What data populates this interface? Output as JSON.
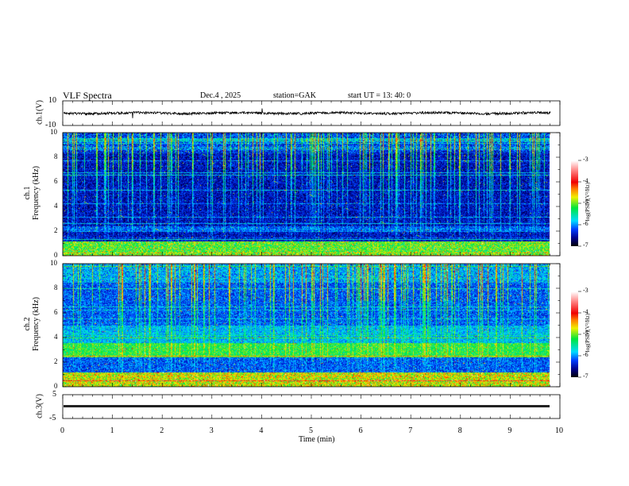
{
  "header": {
    "title": "VLF Spectra",
    "date": "Dec.4 , 2025",
    "station": "station=GAK",
    "start": "start UT = 13: 40: 0"
  },
  "chart_data": [
    {
      "type": "line",
      "ylabel": "ch.1(V)",
      "ylim": [
        -10,
        10
      ],
      "yticks": [
        "10",
        "-10"
      ],
      "xlim": [
        0,
        10
      ],
      "description_level": "noisy waveform near 0 V with spikes"
    },
    {
      "type": "heatmap",
      "ylabel_top": "ch.1",
      "ylabel": "Frequency (kHz)",
      "ylim": [
        0,
        10
      ],
      "yticks": [
        "0",
        "2",
        "4",
        "6",
        "8",
        "10"
      ],
      "xlim": [
        0,
        10
      ],
      "colorbar": {
        "label": "log(PSD)(V²/Hz)",
        "range": [
          -7,
          -3
        ],
        "ticks": [
          "-3",
          "-4",
          "-5",
          "-6",
          "-7"
        ]
      }
    },
    {
      "type": "heatmap",
      "ylabel_top": "ch.2",
      "ylabel": "Frequency (kHz)",
      "ylim": [
        0,
        10
      ],
      "yticks": [
        "0",
        "2",
        "4",
        "6",
        "8",
        "10"
      ],
      "xlim": [
        0,
        10
      ],
      "colorbar": {
        "label": "log(PSD)(V²/Hz)",
        "range": [
          -7,
          -3
        ],
        "ticks": [
          "-3",
          "-4",
          "-5",
          "-6",
          "-7"
        ]
      }
    },
    {
      "type": "line",
      "ylabel": "ch.3(V)",
      "ylim": [
        -5,
        5
      ],
      "yticks": [
        "5",
        "-5"
      ],
      "xlim": [
        0,
        10
      ],
      "xlabel": "Time (min)",
      "xticks": [
        "0",
        "1",
        "2",
        "3",
        "4",
        "5",
        "6",
        "7",
        "8",
        "9",
        "10"
      ]
    }
  ],
  "colors": {
    "waveform": "#000000",
    "background": "#ffffff"
  }
}
